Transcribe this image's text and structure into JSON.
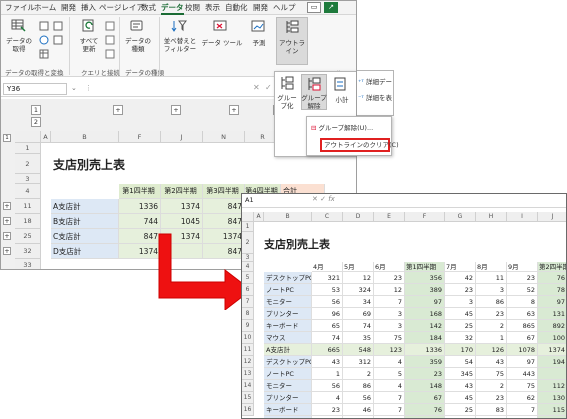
{
  "ribbon_tabs": [
    "ファイル",
    "ホーム",
    "開発",
    "挿入",
    "ページレイア",
    "数式",
    "データ",
    "校閲",
    "表示",
    "自動化",
    "開発",
    "ヘルプ"
  ],
  "active_tab": "データ",
  "ribbon": {
    "get_data": "データの\n取得",
    "get_data_group": "データの取得と変換",
    "refresh_all": "すべて\n更新",
    "query_group": "クエリと接続",
    "data_types": "データの\n種類",
    "data_types_group": "データの種類",
    "sort_filter": "並べ替えと\nフィルター",
    "data_tools": "データ ツール",
    "forecast": "予測",
    "outline": "アウトラ\nイン",
    "group": "グルー\nプ化",
    "ungroup": "グループ\n解除",
    "subtotal": "小計",
    "show_detail": "詳細デー",
    "hide_detail": "詳細を表"
  },
  "menu": {
    "ungroup_item": "グループ解除(U)...",
    "clear_outline": "アウトラインのクリア(C)"
  },
  "namebox1": "Y36",
  "namebox2": "A1",
  "outline_levels": [
    "1",
    "2"
  ],
  "sheet1": {
    "title": "支店別売上表",
    "col_headers": [
      "A",
      "B",
      "F",
      "J",
      "N",
      "R",
      "S"
    ],
    "row_headers": [
      "1",
      "2",
      "3",
      "4",
      "11",
      "18",
      "25",
      "32",
      "33"
    ],
    "header_row": [
      "第1四半期",
      "第2四半期",
      "第3四半期",
      "第4四半期",
      "合計"
    ],
    "rows": [
      {
        "label": "A支店計",
        "values": [
          "1336",
          "1374",
          "847"
        ]
      },
      {
        "label": "B支店計",
        "values": [
          "744",
          "1045",
          "847"
        ]
      },
      {
        "label": "C支店計",
        "values": [
          "847",
          "1374",
          "1374"
        ]
      },
      {
        "label": "D支店計",
        "values": [
          "1374",
          "",
          "847"
        ]
      }
    ]
  },
  "sheet2": {
    "title": "支店別売上表",
    "col_headers": [
      "A",
      "B",
      "C",
      "D",
      "E",
      "F",
      "G",
      "H",
      "I",
      "J"
    ],
    "row_headers": [
      "1",
      "2",
      "3",
      "4",
      "5",
      "6",
      "7",
      "8",
      "9",
      "10",
      "11",
      "12",
      "13",
      "14",
      "15",
      "16",
      "17",
      "18"
    ],
    "header_row": [
      "4月",
      "5月",
      "6月",
      "第1四半期",
      "7月",
      "8月",
      "9月",
      "第2四半期"
    ],
    "rows": [
      {
        "label": "デスクトップPC",
        "values": [
          "321",
          "12",
          "23",
          "356",
          "42",
          "11",
          "23",
          "76"
        ]
      },
      {
        "label": "ノートPC",
        "values": [
          "53",
          "324",
          "12",
          "389",
          "23",
          "3",
          "52",
          "78"
        ]
      },
      {
        "label": "モニター",
        "values": [
          "56",
          "34",
          "7",
          "97",
          "3",
          "86",
          "8",
          "97"
        ]
      },
      {
        "label": "プリンター",
        "values": [
          "96",
          "69",
          "3",
          "168",
          "45",
          "23",
          "63",
          "131"
        ]
      },
      {
        "label": "キーボード",
        "values": [
          "65",
          "74",
          "3",
          "142",
          "25",
          "2",
          "865",
          "892"
        ]
      },
      {
        "label": "マウス",
        "values": [
          "74",
          "35",
          "75",
          "184",
          "32",
          "1",
          "67",
          "100"
        ]
      },
      {
        "label": "A支店計",
        "values": [
          "665",
          "548",
          "123",
          "1336",
          "170",
          "126",
          "1078",
          "1374"
        ]
      },
      {
        "label": "デスクトップPC",
        "values": [
          "43",
          "312",
          "4",
          "359",
          "54",
          "43",
          "97",
          "194"
        ]
      },
      {
        "label": "ノートPC",
        "values": [
          "1",
          "2",
          "5",
          "23",
          "345",
          "75",
          "443",
          ""
        ]
      },
      {
        "label": "モニター",
        "values": [
          "56",
          "86",
          "4",
          "148",
          "43",
          "2",
          "75",
          "112"
        ]
      },
      {
        "label": "プリンター",
        "values": [
          "4",
          "56",
          "7",
          "67",
          "45",
          "23",
          "62",
          "130"
        ]
      },
      {
        "label": "キーボード",
        "values": [
          "23",
          "46",
          "7",
          "76",
          "25",
          "83",
          "7",
          "115"
        ]
      },
      {
        "label": "マウス",
        "values": [
          "78",
          "9",
          "2",
          "89",
          "32",
          "13",
          "6",
          "51"
        ]
      }
    ]
  },
  "colors": {
    "accent_green": "#1e7a3c",
    "highlight_red": "#e02020",
    "arrow_red": "#ee1111",
    "header_green": "#dfeccf",
    "subtotal_green": "#e6f0dc",
    "label_blue": "#dde8f5",
    "quarter_green": "#d9ead3"
  }
}
